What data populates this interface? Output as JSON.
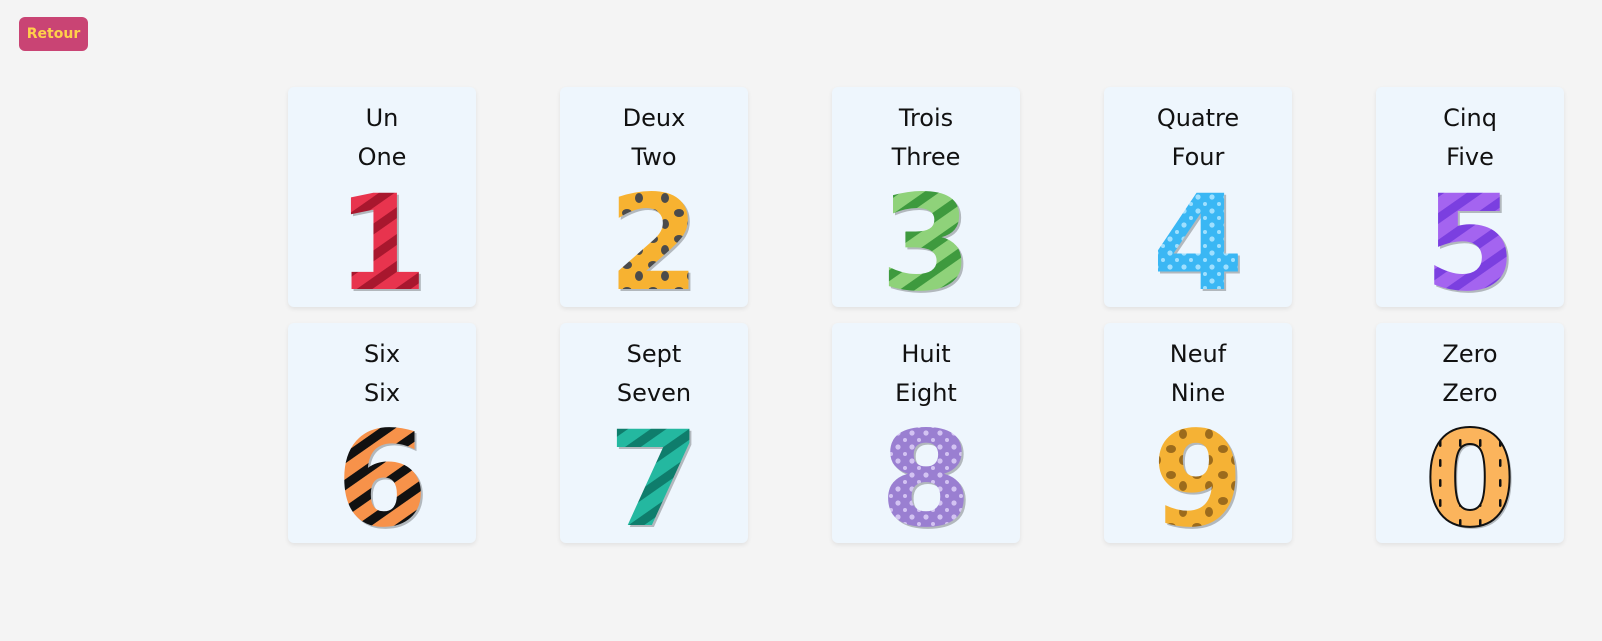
{
  "back_button": {
    "label": "Retour"
  },
  "cards": [
    {
      "fr": "Un",
      "en": "One",
      "digit": "1",
      "icon": "number-one-icon",
      "color": "#e8344e",
      "pattern_color": "#a8172e",
      "pattern": "stripes"
    },
    {
      "fr": "Deux",
      "en": "Two",
      "digit": "2",
      "icon": "number-two-icon",
      "color": "#f7b231",
      "pattern_color": "#4b4b4b",
      "pattern": "spots"
    },
    {
      "fr": "Trois",
      "en": "Three",
      "digit": "3",
      "icon": "number-three-icon",
      "color": "#8fd27a",
      "pattern_color": "#3e9a3e",
      "pattern": "stripes"
    },
    {
      "fr": "Quatre",
      "en": "Four",
      "digit": "4",
      "icon": "number-four-icon",
      "color": "#3ab7f4",
      "pattern_color": "#9fe0ff",
      "pattern": "dots"
    },
    {
      "fr": "Cinq",
      "en": "Five",
      "digit": "5",
      "icon": "number-five-icon",
      "color": "#a464f0",
      "pattern_color": "#7b3fe0",
      "pattern": "stripes"
    },
    {
      "fr": "Six",
      "en": "Six",
      "digit": "6",
      "icon": "number-six-icon",
      "color": "#f7924a",
      "pattern_color": "#111111",
      "pattern": "stripes"
    },
    {
      "fr": "Sept",
      "en": "Seven",
      "digit": "7",
      "icon": "number-seven-icon",
      "color": "#24b8a0",
      "pattern_color": "#0f7d6c",
      "pattern": "stripes"
    },
    {
      "fr": "Huit",
      "en": "Eight",
      "digit": "8",
      "icon": "number-eight-icon",
      "color": "#9a7fd1",
      "pattern_color": "#d3c3f2",
      "pattern": "dots"
    },
    {
      "fr": "Neuf",
      "en": "Nine",
      "digit": "9",
      "icon": "number-nine-icon",
      "color": "#f5b235",
      "pattern_color": "#9c6b1c",
      "pattern": "spots"
    },
    {
      "fr": "Zero",
      "en": "Zero",
      "digit": "0",
      "icon": "number-zero-icon",
      "color": "#fbb45c",
      "pattern_color": "#111111",
      "pattern": "dashes"
    }
  ]
}
